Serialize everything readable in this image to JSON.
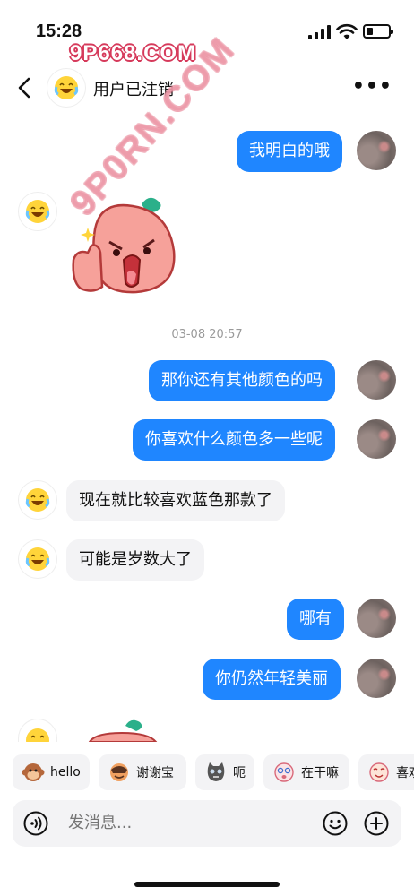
{
  "status_bar": {
    "time": "15:28"
  },
  "watermarks": {
    "top": "9P668.COM",
    "diagonal": "9P0RN.COM"
  },
  "header": {
    "title": "用户已注销",
    "back_icon": "chevron-left-icon",
    "more_icon": "more-dots-icon"
  },
  "messages": [
    {
      "side": "me",
      "text": "我明白的哦"
    },
    {
      "side": "them",
      "sticker": "peach-thumbs-up-sticker"
    },
    {
      "side": "me",
      "text": "那你还有其他颜色的吗"
    },
    {
      "side": "me",
      "text": "你喜欢什么颜色多一些呢"
    },
    {
      "side": "them",
      "text": "现在就比较喜欢蓝色那款了"
    },
    {
      "side": "them",
      "text": "可能是岁数大了"
    },
    {
      "side": "me",
      "text": "哪有"
    },
    {
      "side": "me",
      "text": "你仍然年轻美丽"
    }
  ],
  "timestamp": "03-08 20:57",
  "quick_replies": [
    {
      "label": "hello",
      "icon": "monkey-icon"
    },
    {
      "label": "谢谢宝",
      "icon": "bow-emoji-icon"
    },
    {
      "label": "呃",
      "icon": "cat-icon"
    },
    {
      "label": "在干嘛",
      "icon": "dizzy-face-icon"
    },
    {
      "label": "喜欢",
      "icon": "love-face-icon"
    }
  ],
  "input": {
    "placeholder": "发消息..."
  },
  "colors": {
    "accent": "#1f86ff",
    "bubble_them": "#f3f3f5",
    "background": "#ffffff"
  }
}
